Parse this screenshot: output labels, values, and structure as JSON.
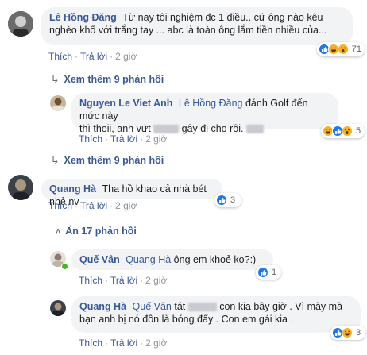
{
  "comments": [
    {
      "author": "Lê Hồng Đăng",
      "text_line1": "Từ nay tôi nghiệm đc 1 điều.. cứ ông nào kêu",
      "text_line2": "nghèo khổ với trắng tay ... abc là toàn ông lắm tiền nhiều của...",
      "actions": {
        "like": "Thích",
        "reply": "Trả lời",
        "time": "2 giờ"
      },
      "reactions": {
        "types": [
          "like-icon",
          "haha-icon",
          "wow-icon"
        ],
        "count": "71"
      },
      "more_replies": "Xem thêm 9 phản hồi",
      "replies": [
        {
          "author": "Nguyen Le Viet Anh",
          "mention": "Lê Hồng Đăng",
          "text_a": "đánh Golf đến mức này",
          "text_b1": "thì thoii, anh vứt",
          "text_b2": "gậy đi cho rồi.",
          "actions": {
            "like": "Thích",
            "reply": "Trả lời",
            "time": "2 giờ"
          },
          "reactions": {
            "types": [
              "haha-icon",
              "like-icon",
              "wow-icon"
            ],
            "count": "5"
          }
        }
      ],
      "more_replies_2": "Xem thêm 9 phản hồi"
    },
    {
      "author": "Quang Hà",
      "text": "Tha hồ khao cả nhà bét nhẻ nv",
      "actions": {
        "like": "Thích",
        "reply": "Trả lời",
        "time": "2 giờ"
      },
      "reactions": {
        "types": [
          "like-icon"
        ],
        "count": "3"
      },
      "hide_replies": "Ẩn 17 phản hồi",
      "replies": [
        {
          "author": "Quế Vân",
          "mention": "Quang Hà",
          "text": "ông em khoẻ ko?:)",
          "actions": {
            "like": "Thích",
            "reply": "Trả lời",
            "time": "2 giờ"
          },
          "reactions": {
            "types": [
              "like-icon"
            ],
            "count": "1"
          }
        },
        {
          "author": "Quang Hà",
          "mention": "Quế Vân",
          "text_a1": "tát",
          "text_a2": "con kia bây giờ . Vì mày mà",
          "text_b": "bạn anh bị nó đồn là bóng đấy . Con em gái kia .",
          "actions": {
            "like": "Thích",
            "reply": "Trả lời",
            "time": "2 giờ"
          },
          "reactions": {
            "types": [
              "like-icon",
              "haha-icon"
            ],
            "count": "3"
          }
        }
      ]
    }
  ],
  "colors": {
    "link": "#385898",
    "bubble": "#f2f3f5",
    "like": "#1877f2",
    "emoji": "#f7b125"
  }
}
